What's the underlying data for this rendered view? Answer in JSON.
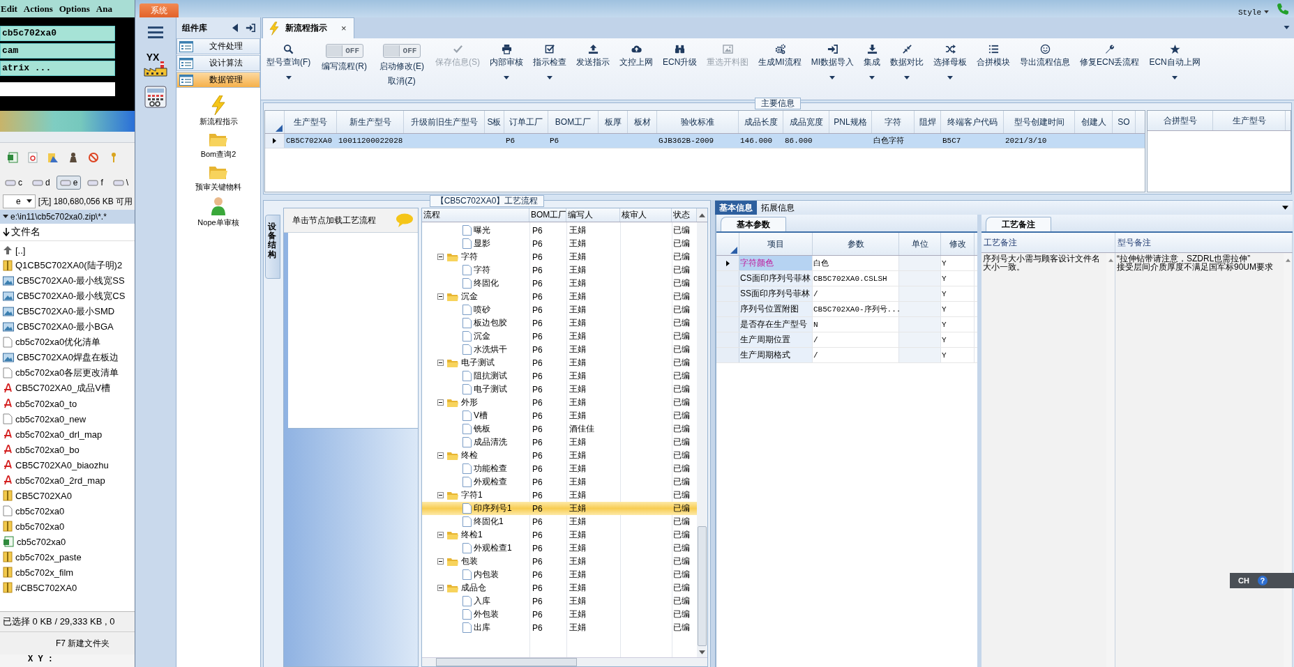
{
  "background_app": {
    "menu": [
      "Edit",
      "Actions",
      "Options",
      "Ana"
    ],
    "fields": [
      "cb5c702xa0",
      "cam",
      "atrix ..."
    ],
    "drives": [
      {
        "label": "c",
        "selected": false
      },
      {
        "label": "d",
        "selected": false
      },
      {
        "label": "e",
        "selected": true
      },
      {
        "label": "f",
        "selected": false
      },
      {
        "label": "\\",
        "selected": false
      }
    ],
    "drive_select": "e",
    "free_space": "[无] 180,680,056 KB 可用",
    "path": "e:\\in11\\cb5c702xa0.zip\\*.*",
    "column": "文件名",
    "files": [
      {
        "name": "[..]",
        "kind": "up"
      },
      {
        "name": "Q1CB5C702XA0(陆子明)2",
        "kind": "zip"
      },
      {
        "name": "CB5C702XA0-最小线宽SS",
        "kind": "image"
      },
      {
        "name": "CB5C702XA0-最小线宽CS",
        "kind": "image"
      },
      {
        "name": "CB5C702XA0-最小SMD",
        "kind": "image"
      },
      {
        "name": "CB5C702XA0-最小BGA",
        "kind": "image"
      },
      {
        "name": "cb5c702xa0优化清单",
        "kind": "text"
      },
      {
        "name": "CB5C702XA0焊盘在板边",
        "kind": "image"
      },
      {
        "name": "cb5c702xa0各层更改清单",
        "kind": "text"
      },
      {
        "name": "CB5C702XA0_成品V槽",
        "kind": "pdf"
      },
      {
        "name": "cb5c702xa0_to",
        "kind": "pdf"
      },
      {
        "name": "cb5c702xa0_new",
        "kind": "text"
      },
      {
        "name": "cb5c702xa0_drl_map",
        "kind": "pdf"
      },
      {
        "name": "cb5c702xa0_bo",
        "kind": "pdf"
      },
      {
        "name": "CB5C702XA0_biaozhu",
        "kind": "pdf"
      },
      {
        "name": "cb5c702xa0_2rd_map",
        "kind": "pdf"
      },
      {
        "name": "CB5C702XA0",
        "kind": "zip"
      },
      {
        "name": "cb5c702xa0",
        "kind": "text"
      },
      {
        "name": "cb5c702xa0",
        "kind": "zip"
      },
      {
        "name": "cb5c702xa0",
        "kind": "excel"
      },
      {
        "name": "cb5c702x_paste",
        "kind": "zip"
      },
      {
        "name": "cb5c702x_film",
        "kind": "zip"
      },
      {
        "name": "#CB5C702XA0",
        "kind": "zip"
      }
    ],
    "status": "已选择 0 KB / 29,333 KB , 0",
    "function_key": "F7 新建文件夹",
    "coords": "X Y :"
  },
  "app": {
    "system_tab": "系统",
    "style_menu": "Style",
    "logo_text": "YX",
    "library": {
      "title": "组件库",
      "categories": [
        {
          "label": "文件处理",
          "selected": false
        },
        {
          "label": "设计算法",
          "selected": false
        },
        {
          "label": "数据管理",
          "selected": true
        }
      ],
      "modules": [
        {
          "label": "新流程指示",
          "kind": "bolt"
        },
        {
          "label": "Bom查询2",
          "kind": "folder"
        },
        {
          "label": "预审关键物料",
          "kind": "folder"
        },
        {
          "label": "Nope单审核",
          "kind": "person"
        }
      ]
    },
    "tab": {
      "label": "新流程指示",
      "close": "×"
    },
    "toolbar": [
      {
        "kind": "button",
        "label": "型号查询(F)",
        "dropdown": true,
        "disabled": false
      },
      {
        "kind": "toggle",
        "label": "编写流程(R)",
        "state": "OFF",
        "on": false
      },
      {
        "kind": "toggle",
        "label": "启动修改(E)",
        "second_label": "取消(Z)",
        "state": "OFF",
        "on": false
      },
      {
        "kind": "button",
        "label": "保存信息(S)",
        "dropdown": false,
        "disabled": true
      },
      {
        "kind": "button",
        "label": "内部审核",
        "dropdown": true,
        "disabled": false
      },
      {
        "kind": "button",
        "label": "指示检查",
        "dropdown": true,
        "disabled": false
      },
      {
        "kind": "button",
        "label": "发送指示",
        "dropdown": false,
        "disabled": false
      },
      {
        "kind": "button",
        "label": "文控上网",
        "dropdown": false,
        "disabled": false
      },
      {
        "kind": "button",
        "label": "ECN升级",
        "dropdown": false,
        "disabled": false
      },
      {
        "kind": "button",
        "label": "重选开料图",
        "dropdown": false,
        "disabled": true
      },
      {
        "kind": "button",
        "label": "生成MI流程",
        "dropdown": false,
        "disabled": false
      },
      {
        "kind": "button",
        "label": "MI数据导入",
        "dropdown": true,
        "disabled": false
      },
      {
        "kind": "button",
        "label": "集成",
        "dropdown": true,
        "disabled": false
      },
      {
        "kind": "button",
        "label": "数据对比",
        "dropdown": true,
        "disabled": false
      },
      {
        "kind": "button",
        "label": "选择母板",
        "dropdown": true,
        "disabled": false
      },
      {
        "kind": "button",
        "label": "合拼模块",
        "dropdown": false,
        "disabled": false
      },
      {
        "kind": "button",
        "label": "导出流程信息",
        "dropdown": false,
        "disabled": false
      },
      {
        "kind": "button",
        "label": "修复ECN丢流程",
        "dropdown": false,
        "disabled": false
      },
      {
        "kind": "button",
        "label": "ECN自动上网",
        "dropdown": true,
        "disabled": false
      }
    ],
    "main_info": {
      "title": "主要信息",
      "columns": [
        "生产型号",
        "新生产型号",
        "升级前旧生产型号",
        "S板",
        "订单工厂",
        "BOM工厂",
        "板厚",
        "板材",
        "验收标准",
        "成品长度",
        "成品宽度",
        "PNL规格",
        "字符",
        "阻焊",
        "终端客户代码",
        "型号创建时间",
        "创建人",
        "SO"
      ],
      "rows": [
        {
          "selected": true,
          "cells": [
            "CB5C702XA0",
            "10011200022028",
            null,
            null,
            "P6",
            "P6",
            null,
            null,
            "GJB362B-2009",
            "146.000",
            "86.000",
            null,
            "白色字符",
            null,
            "B5C7",
            "2021/3/10",
            null,
            null
          ]
        }
      ],
      "side_columns": [
        "合拼型号",
        "生产型号"
      ]
    },
    "process": {
      "title": "【CB5C702XA0】工艺流程",
      "side_tab": "设备结构",
      "hint": "单击节点加载工艺流程",
      "columns": [
        "流程",
        "BOM工厂",
        "编写人",
        "核审人",
        "状态"
      ],
      "tree": [
        {
          "children": [
            {
              "label": "曝光",
              "bom": "P6",
              "writer": "王娟",
              "status": "已编",
              "selected": false
            },
            {
              "label": "显影",
              "bom": "P6",
              "writer": "王娟",
              "status": "已编",
              "selected": false
            }
          ]
        },
        {
          "label": "字符",
          "bom": "P6",
          "writer": "王娟",
          "status": "已编",
          "selected": false,
          "expanded": true,
          "children": [
            {
              "label": "字符",
              "bom": "P6",
              "writer": "王娟",
              "status": "已编",
              "selected": false
            },
            {
              "label": "终固化",
              "bom": "P6",
              "writer": "王娟",
              "status": "已编",
              "selected": false
            }
          ]
        },
        {
          "label": "沉金",
          "bom": "P6",
          "writer": "王娟",
          "status": "已编",
          "selected": false,
          "expanded": true,
          "children": [
            {
              "label": "喷砂",
              "bom": "P6",
              "writer": "王娟",
              "status": "已编",
              "selected": false
            },
            {
              "label": "板边包胶",
              "bom": "P6",
              "writer": "王娟",
              "status": "已编",
              "selected": false
            },
            {
              "label": "沉金",
              "bom": "P6",
              "writer": "王娟",
              "status": "已编",
              "selected": false
            },
            {
              "label": "水洗烘干",
              "bom": "P6",
              "writer": "王娟",
              "status": "已编",
              "selected": false
            }
          ]
        },
        {
          "label": "电子测试",
          "bom": "P6",
          "writer": "王娟",
          "status": "已编",
          "selected": false,
          "expanded": true,
          "children": [
            {
              "label": "阻抗测试",
              "bom": "P6",
              "writer": "王娟",
              "status": "已编",
              "selected": false
            },
            {
              "label": "电子测试",
              "bom": "P6",
              "writer": "王娟",
              "status": "已编",
              "selected": false
            }
          ]
        },
        {
          "label": "外形",
          "bom": "P6",
          "writer": "王娟",
          "status": "已编",
          "selected": false,
          "expanded": true,
          "children": [
            {
              "label": "V槽",
              "bom": "P6",
              "writer": "王娟",
              "status": "已编",
              "selected": false
            },
            {
              "label": "铣板",
              "bom": "P6",
              "writer": "酒佳佳",
              "status": "已编",
              "selected": false
            },
            {
              "label": "成品清洗",
              "bom": "P6",
              "writer": "王娟",
              "status": "已编",
              "selected": false
            }
          ]
        },
        {
          "label": "终检",
          "bom": "P6",
          "writer": "王娟",
          "status": "已编",
          "selected": false,
          "expanded": true,
          "children": [
            {
              "label": "功能检查",
              "bom": "P6",
              "writer": "王娟",
              "status": "已编",
              "selected": false
            },
            {
              "label": "外观检查",
              "bom": "P6",
              "writer": "王娟",
              "status": "已编",
              "selected": false
            }
          ]
        },
        {
          "label": "字符1",
          "bom": "P6",
          "writer": "王娟",
          "status": "已编",
          "selected": false,
          "expanded": true,
          "children": [
            {
              "label": "印序列号1",
              "bom": "P6",
              "writer": "王娟",
              "status": "已编",
              "selected": true
            },
            {
              "label": "终固化1",
              "bom": "P6",
              "writer": "王娟",
              "status": "已编",
              "selected": false
            }
          ]
        },
        {
          "label": "终检1",
          "bom": "P6",
          "writer": "王娟",
          "status": "已编",
          "selected": false,
          "expanded": true,
          "children": [
            {
              "label": "外观检查1",
              "bom": "P6",
              "writer": "王娟",
              "status": "已编",
              "selected": false
            }
          ]
        },
        {
          "label": "包装",
          "bom": "P6",
          "writer": "王娟",
          "status": "已编",
          "selected": false,
          "expanded": true,
          "children": [
            {
              "label": "内包装",
              "bom": "P6",
              "writer": "王娟",
              "status": "已编",
              "selected": false
            }
          ]
        },
        {
          "label": "成品仓",
          "bom": "P6",
          "writer": "王娟",
          "status": "已编",
          "selected": false,
          "expanded": true,
          "children": [
            {
              "label": "入库",
              "bom": "P6",
              "writer": "王娟",
              "status": "已编",
              "selected": false
            },
            {
              "label": "外包装",
              "bom": "P6",
              "writer": "王娟",
              "status": "已编",
              "selected": false
            },
            {
              "label": "出库",
              "bom": "P6",
              "writer": "王娟",
              "status": "已编",
              "selected": false
            }
          ]
        }
      ]
    },
    "detail": {
      "tabs": [
        {
          "label": "基本信息",
          "selected": true
        },
        {
          "label": "拓展信息",
          "selected": false
        }
      ],
      "params": {
        "tab": "基本参数",
        "columns": [
          "项目",
          "参数",
          "单位",
          "修改"
        ],
        "rows": [
          {
            "selected": true,
            "cells": [
              "字符颜色",
              "白色",
              null,
              "Y"
            ]
          },
          {
            "selected": false,
            "cells": [
              "CS面印序列号菲林",
              "CB5C702XA0.CSLSH",
              null,
              "Y"
            ]
          },
          {
            "selected": false,
            "cells": [
              "SS面印序列号菲林",
              "/",
              null,
              "Y"
            ]
          },
          {
            "selected": false,
            "cells": [
              "序列号位置附图",
              "CB5C702XA0-序列号...",
              null,
              "Y"
            ]
          },
          {
            "selected": false,
            "cells": [
              "是否存在生产型号",
              "N",
              null,
              "Y"
            ]
          },
          {
            "selected": false,
            "cells": [
              "生产周期位置",
              "/",
              null,
              "Y"
            ]
          },
          {
            "selected": false,
            "cells": [
              "生产周期格式",
              "/",
              null,
              "Y"
            ]
          }
        ]
      },
      "notes": {
        "tab": "工艺备注",
        "columns": [
          "工艺备注",
          "型号备注"
        ],
        "values": [
          [
            "序列号大小需与顾客设计文件名",
            "大小一致。"
          ],
          [
            "“拉伸钻带请注意，SZDRL也需拉伸”",
            "接受层间介质厚度不满足国军标90UM要求"
          ]
        ]
      }
    },
    "language_bar": {
      "label": "CH",
      "help": "?"
    }
  }
}
